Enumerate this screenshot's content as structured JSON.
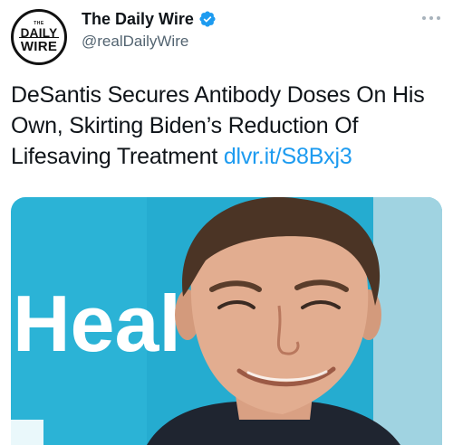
{
  "account": {
    "avatar_text": {
      "top": "THE",
      "line1": "DAILY",
      "line2": "WIRE"
    },
    "display_name": "The Daily Wire",
    "handle": "@realDailyWire",
    "verified": true,
    "verified_icon": "verified-badge-icon"
  },
  "tweet": {
    "text": "DeSantis Secures Antibody Doses On His Own, Skirting Biden’s Reduction Of Lifesaving Treatment ",
    "link": "dlvr.it/S8Bxj3"
  },
  "media": {
    "sign_text": "Heal"
  },
  "colors": {
    "link": "#1d9bf0",
    "verified": "#1d9bf0",
    "handle": "#536471",
    "sign_background": "#2bb3d6"
  },
  "icons": {
    "more": "more-options-icon"
  }
}
